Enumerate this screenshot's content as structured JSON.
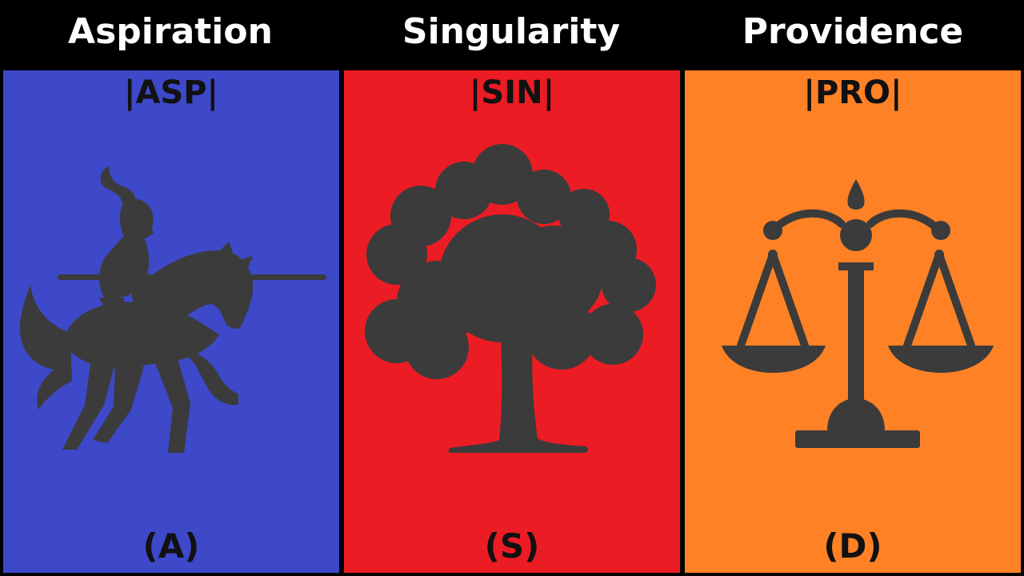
{
  "columns": [
    {
      "heading": "Aspiration",
      "code": "|ASP|",
      "letter": "(A)",
      "color": "#3d49c9",
      "icon": "knight-on-horse-icon"
    },
    {
      "heading": "Singularity",
      "code": "|SIN|",
      "letter": "(S)",
      "color": "#ec1c24",
      "icon": "tree-icon"
    },
    {
      "heading": "Providence",
      "code": "|PRO|",
      "letter": "(D)",
      "color": "#fe8125",
      "icon": "scales-of-justice-icon"
    }
  ],
  "icon_color": "#3b3b3b",
  "background": "#000000"
}
